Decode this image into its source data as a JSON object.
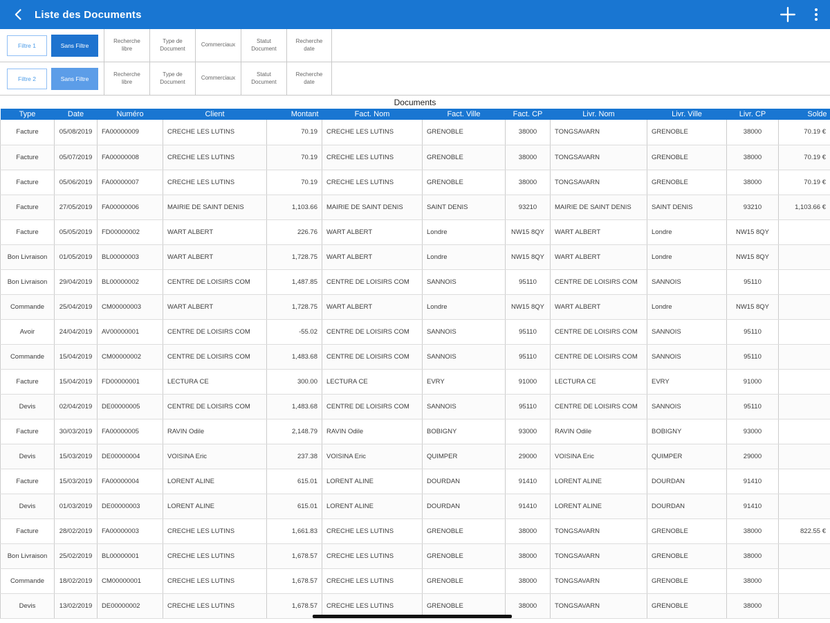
{
  "app_bar": {
    "title": "Liste des Documents",
    "back_icon": "chevron-left",
    "add_icon": "plus",
    "menu_icon": "kebab-menu",
    "color": "#1976d2"
  },
  "filters": {
    "rows": [
      {
        "label": "Filtre 1",
        "active": "Sans Filtre",
        "active_color": "#1e73cf",
        "buttons": [
          "Recherche libre",
          "Type de Document",
          "Commerciaux",
          "Statut Document",
          "Recherche date"
        ]
      },
      {
        "label": "Filtre 2",
        "active": "Sans Filtre",
        "active_color": "#5c9de8",
        "buttons": [
          "Recherche libre",
          "Type de Document",
          "Commerciaux",
          "Statut Document",
          "Recherche date"
        ]
      }
    ]
  },
  "table": {
    "title": "Documents",
    "columns": [
      "Type",
      "Date",
      "Numéro",
      "Client",
      "Montant",
      "Fact. Nom",
      "Fact. Ville",
      "Fact. CP",
      "Livr. Nom",
      "Livr. Ville",
      "Livr. CP",
      "Solde"
    ],
    "rows": [
      [
        "Facture",
        "05/08/2019",
        "FA00000009",
        "CRECHE LES LUTINS",
        "70.19",
        "CRECHE LES LUTINS",
        "GRENOBLE",
        "38000",
        "TONGSAVARN",
        "GRENOBLE",
        "38000",
        "70.19 €"
      ],
      [
        "Facture",
        "05/07/2019",
        "FA00000008",
        "CRECHE LES LUTINS",
        "70.19",
        "CRECHE LES LUTINS",
        "GRENOBLE",
        "38000",
        "TONGSAVARN",
        "GRENOBLE",
        "38000",
        "70.19 €"
      ],
      [
        "Facture",
        "05/06/2019",
        "FA00000007",
        "CRECHE LES LUTINS",
        "70.19",
        "CRECHE LES LUTINS",
        "GRENOBLE",
        "38000",
        "TONGSAVARN",
        "GRENOBLE",
        "38000",
        "70.19 €"
      ],
      [
        "Facture",
        "27/05/2019",
        "FA00000006",
        "MAIRIE DE SAINT DENIS",
        "1,103.66",
        "MAIRIE DE SAINT DENIS",
        "SAINT DENIS",
        "93210",
        "MAIRIE DE SAINT DENIS",
        "SAINT DENIS",
        "93210",
        "1,103.66 €"
      ],
      [
        "Facture",
        "05/05/2019",
        "FD00000002",
        "WART ALBERT",
        "226.76",
        "WART ALBERT",
        "Londre",
        "NW15 8QY",
        "WART ALBERT",
        "Londre",
        "NW15 8QY",
        ""
      ],
      [
        "Bon Livraison",
        "01/05/2019",
        "BL00000003",
        "WART ALBERT",
        "1,728.75",
        "WART ALBERT",
        "Londre",
        "NW15 8QY",
        "WART ALBERT",
        "Londre",
        "NW15 8QY",
        ""
      ],
      [
        "Bon Livraison",
        "29/04/2019",
        "BL00000002",
        "CENTRE DE LOISIRS COM",
        "1,487.85",
        "CENTRE DE LOISIRS COM",
        "SANNOIS",
        "95110",
        "CENTRE DE LOISIRS COM",
        "SANNOIS",
        "95110",
        ""
      ],
      [
        "Commande",
        "25/04/2019",
        "CM00000003",
        "WART ALBERT",
        "1,728.75",
        "WART ALBERT",
        "Londre",
        "NW15 8QY",
        "WART ALBERT",
        "Londre",
        "NW15 8QY",
        ""
      ],
      [
        "Avoir",
        "24/04/2019",
        "AV00000001",
        "CENTRE DE LOISIRS COM",
        "-55.02",
        "CENTRE DE LOISIRS COM",
        "SANNOIS",
        "95110",
        "CENTRE DE LOISIRS COM",
        "SANNOIS",
        "95110",
        ""
      ],
      [
        "Commande",
        "15/04/2019",
        "CM00000002",
        "CENTRE DE LOISIRS COM",
        "1,483.68",
        "CENTRE DE LOISIRS COM",
        "SANNOIS",
        "95110",
        "CENTRE DE LOISIRS COM",
        "SANNOIS",
        "95110",
        ""
      ],
      [
        "Facture",
        "15/04/2019",
        "FD00000001",
        "LECTURA CE",
        "300.00",
        "LECTURA CE",
        "EVRY",
        "91000",
        "LECTURA CE",
        "EVRY",
        "91000",
        ""
      ],
      [
        "Devis",
        "02/04/2019",
        "DE00000005",
        "CENTRE DE LOISIRS COM",
        "1,483.68",
        "CENTRE DE LOISIRS COM",
        "SANNOIS",
        "95110",
        "CENTRE DE LOISIRS COM",
        "SANNOIS",
        "95110",
        ""
      ],
      [
        "Facture",
        "30/03/2019",
        "FA00000005",
        "RAVIN Odile",
        "2,148.79",
        "RAVIN Odile",
        "BOBIGNY",
        "93000",
        "RAVIN Odile",
        "BOBIGNY",
        "93000",
        ""
      ],
      [
        "Devis",
        "15/03/2019",
        "DE00000004",
        "VOISINA Eric",
        "237.38",
        "VOISINA Eric",
        "QUIMPER",
        "29000",
        "VOISINA Eric",
        "QUIMPER",
        "29000",
        ""
      ],
      [
        "Facture",
        "15/03/2019",
        "FA00000004",
        "LORENT ALINE",
        "615.01",
        "LORENT ALINE",
        "DOURDAN",
        "91410",
        "LORENT ALINE",
        "DOURDAN",
        "91410",
        ""
      ],
      [
        "Devis",
        "01/03/2019",
        "DE00000003",
        "LORENT ALINE",
        "615.01",
        "LORENT ALINE",
        "DOURDAN",
        "91410",
        "LORENT ALINE",
        "DOURDAN",
        "91410",
        ""
      ],
      [
        "Facture",
        "28/02/2019",
        "FA00000003",
        "CRECHE LES LUTINS",
        "1,661.83",
        "CRECHE LES LUTINS",
        "GRENOBLE",
        "38000",
        "TONGSAVARN",
        "GRENOBLE",
        "38000",
        "822.55 €"
      ],
      [
        "Bon Livraison",
        "25/02/2019",
        "BL00000001",
        "CRECHE LES LUTINS",
        "1,678.57",
        "CRECHE LES LUTINS",
        "GRENOBLE",
        "38000",
        "TONGSAVARN",
        "GRENOBLE",
        "38000",
        ""
      ],
      [
        "Commande",
        "18/02/2019",
        "CM00000001",
        "CRECHE LES LUTINS",
        "1,678.57",
        "CRECHE LES LUTINS",
        "GRENOBLE",
        "38000",
        "TONGSAVARN",
        "GRENOBLE",
        "38000",
        ""
      ],
      [
        "Devis",
        "13/02/2019",
        "DE00000002",
        "CRECHE LES LUTINS",
        "1,678.57",
        "CRECHE LES LUTINS",
        "GRENOBLE",
        "38000",
        "TONGSAVARN",
        "GRENOBLE",
        "38000",
        ""
      ]
    ]
  }
}
